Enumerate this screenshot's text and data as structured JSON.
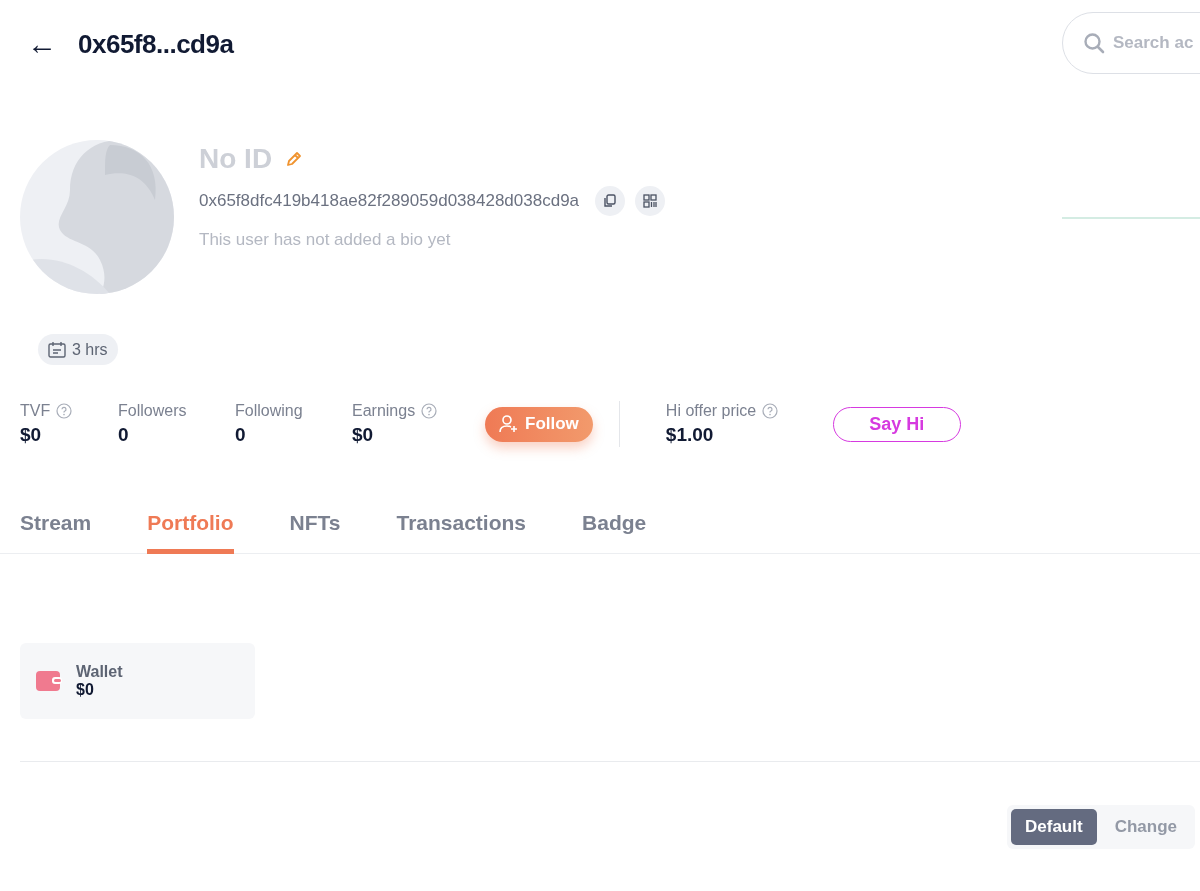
{
  "header": {
    "back": "←",
    "title": "0x65f8...cd9a",
    "search": {
      "placeholder": "Search ac"
    }
  },
  "profile": {
    "name": "No ID",
    "address": "0x65f8dfc419b418ae82f289059d038428d038cd9a",
    "bio": "This user has not added a bio yet",
    "badge": "3 hrs"
  },
  "stats": [
    {
      "label": "TVF",
      "value": "$0",
      "help": true
    },
    {
      "label": "Followers",
      "value": "0",
      "help": false
    },
    {
      "label": "Following",
      "value": "0",
      "help": false
    },
    {
      "label": "Earnings",
      "value": "$0",
      "help": true
    }
  ],
  "follow_button": "Follow",
  "offer": {
    "label": "Hi offer price",
    "value": "$1.00",
    "help": true
  },
  "say_hi_button": "Say Hi",
  "tabs": [
    {
      "label": "Stream",
      "selected": false
    },
    {
      "label": "Portfolio",
      "selected": true
    },
    {
      "label": "NFTs",
      "selected": false
    },
    {
      "label": "Transactions",
      "selected": false
    },
    {
      "label": "Badge",
      "selected": false
    }
  ],
  "wallet": {
    "label": "Wallet",
    "value": "$0"
  },
  "toggle": [
    {
      "label": "Default",
      "selected": true
    },
    {
      "label": "Change",
      "selected": false
    }
  ]
}
